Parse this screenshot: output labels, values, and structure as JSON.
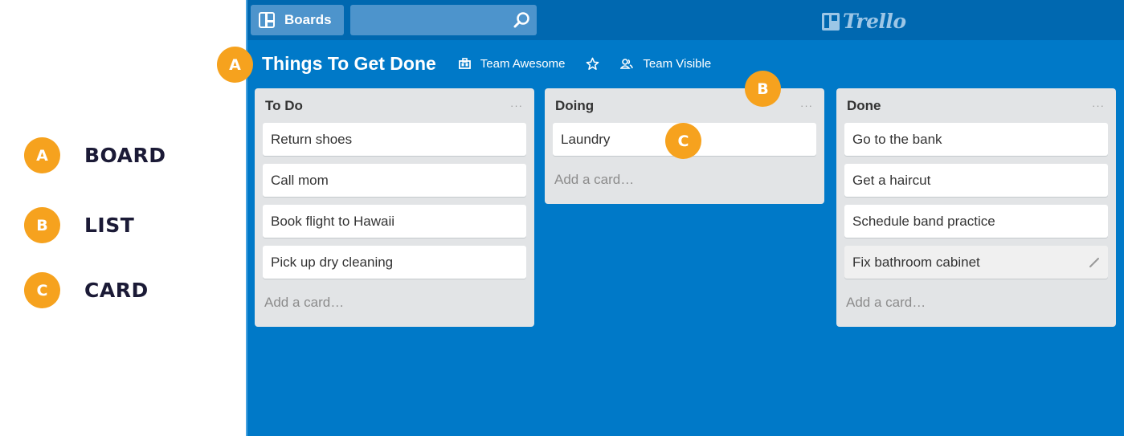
{
  "legend": [
    {
      "letter": "A",
      "label": "BOARD"
    },
    {
      "letter": "B",
      "label": "LIST"
    },
    {
      "letter": "C",
      "label": "CARD"
    }
  ],
  "callouts": {
    "board": "A",
    "list": "B",
    "card": "C"
  },
  "topbar": {
    "boards_label": "Boards",
    "search_value": "",
    "search_icon": "search-icon",
    "logo_text": "Trello"
  },
  "board": {
    "title": "Things To Get Done",
    "team_label": "Team Awesome",
    "star_icon": "star-icon",
    "visibility_label": "Team Visible"
  },
  "colors": {
    "board_bg": "#0079c8",
    "topbar_bg": "#0068b0",
    "badge": "#f6a21e",
    "list_bg": "#e2e4e6"
  },
  "lists": [
    {
      "title": "To Do",
      "menu": "···",
      "cards": [
        "Return shoes",
        "Call mom",
        "Book flight to Hawaii",
        "Pick up dry cleaning"
      ],
      "add_card": "Add a card…"
    },
    {
      "title": "Doing",
      "menu": "···",
      "cards": [
        "Laundry"
      ],
      "add_card": "Add a card…"
    },
    {
      "title": "Done",
      "menu": "···",
      "cards": [
        "Go to the bank",
        "Get a haircut",
        "Schedule band practice",
        "Fix bathroom cabinet"
      ],
      "add_card": "Add a card…"
    }
  ]
}
